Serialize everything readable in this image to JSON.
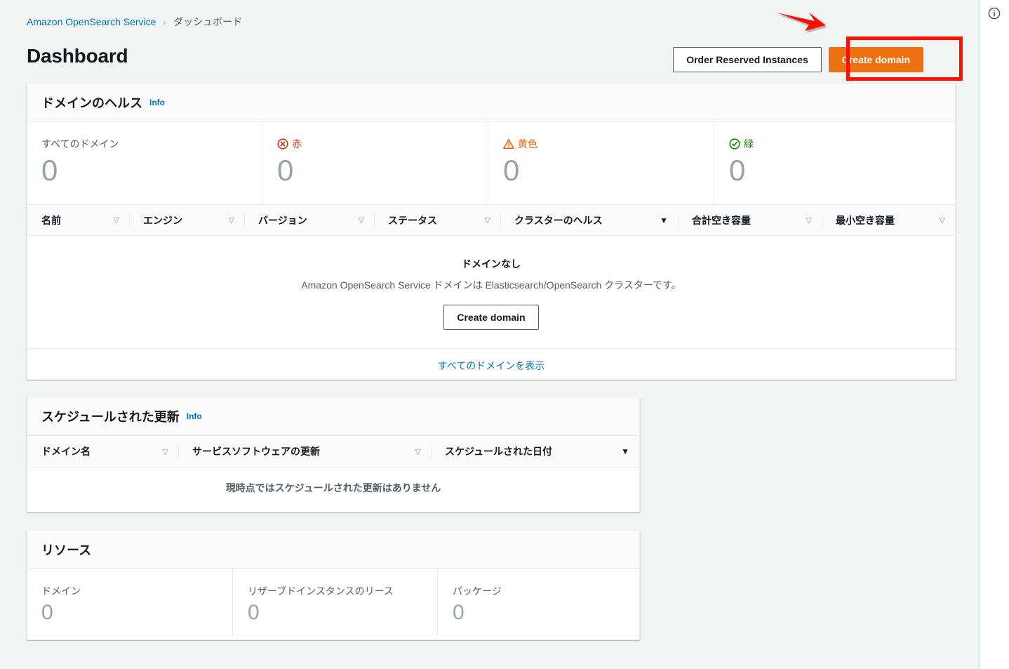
{
  "breadcrumb": {
    "root": "Amazon OpenSearch Service",
    "separator": "›",
    "current": "ダッシュボード"
  },
  "header": {
    "title": "Dashboard",
    "order_reserved_instances_label": "Order Reserved Instances",
    "create_domain_label": "Create domain"
  },
  "annotation": {
    "highlight_color": "#fa0f00",
    "arrow_color": "#fa0f00",
    "target": "create-domain-button"
  },
  "colors": {
    "primary_button": "#ec7211",
    "link": "#0073bb",
    "red_status": "#d13212",
    "yellow_status": "#eb5f07",
    "green_status": "#1d8102",
    "page_background": "#f2f3f3"
  },
  "domain_health": {
    "title": "ドメインのヘルス",
    "info_label": "Info",
    "metrics": [
      {
        "label": "すべてのドメイン",
        "value": "0",
        "icon": "",
        "tone": "plain"
      },
      {
        "label": "赤",
        "value": "0",
        "icon": "error-circle-icon",
        "tone": "red"
      },
      {
        "label": "黄色",
        "value": "0",
        "icon": "warning-triangle-icon",
        "tone": "orange"
      },
      {
        "label": "緑",
        "value": "0",
        "icon": "check-circle-icon",
        "tone": "green"
      }
    ],
    "table": {
      "columns": [
        {
          "label": "名前",
          "sort": "inactive"
        },
        {
          "label": "エンジン",
          "sort": "inactive"
        },
        {
          "label": "バージョン",
          "sort": "inactive"
        },
        {
          "label": "ステータス",
          "sort": "inactive"
        },
        {
          "label": "クラスターのヘルス",
          "sort": "active"
        },
        {
          "label": "合計空き容量",
          "sort": "inactive"
        },
        {
          "label": "最小空き容量",
          "sort": "inactive"
        }
      ],
      "sort_icon_inactive": "▽",
      "sort_icon_active": "▼",
      "empty_title": "ドメインなし",
      "empty_description": "Amazon OpenSearch Service ドメインは Elasticsearch/OpenSearch クラスターです。",
      "empty_button_label": "Create domain",
      "footer_link": "すべてのドメインを表示"
    }
  },
  "scheduled_updates": {
    "title": "スケジュールされた更新",
    "info_label": "Info",
    "columns": [
      {
        "label": "ドメイン名",
        "sort": "inactive"
      },
      {
        "label": "サービスソフトウェアの更新",
        "sort": "inactive"
      },
      {
        "label": "スケジュールされた日付",
        "sort": "active"
      }
    ],
    "empty_message": "現時点ではスケジュールされた更新はありません"
  },
  "resources": {
    "title": "リソース",
    "metrics": [
      {
        "label": "ドメイン",
        "value": "0"
      },
      {
        "label": "リザーブドインスタンスのリース",
        "value": "0"
      },
      {
        "label": "パッケージ",
        "value": "0"
      }
    ]
  },
  "right_rail": {
    "info_icon": "info-circle-icon"
  }
}
